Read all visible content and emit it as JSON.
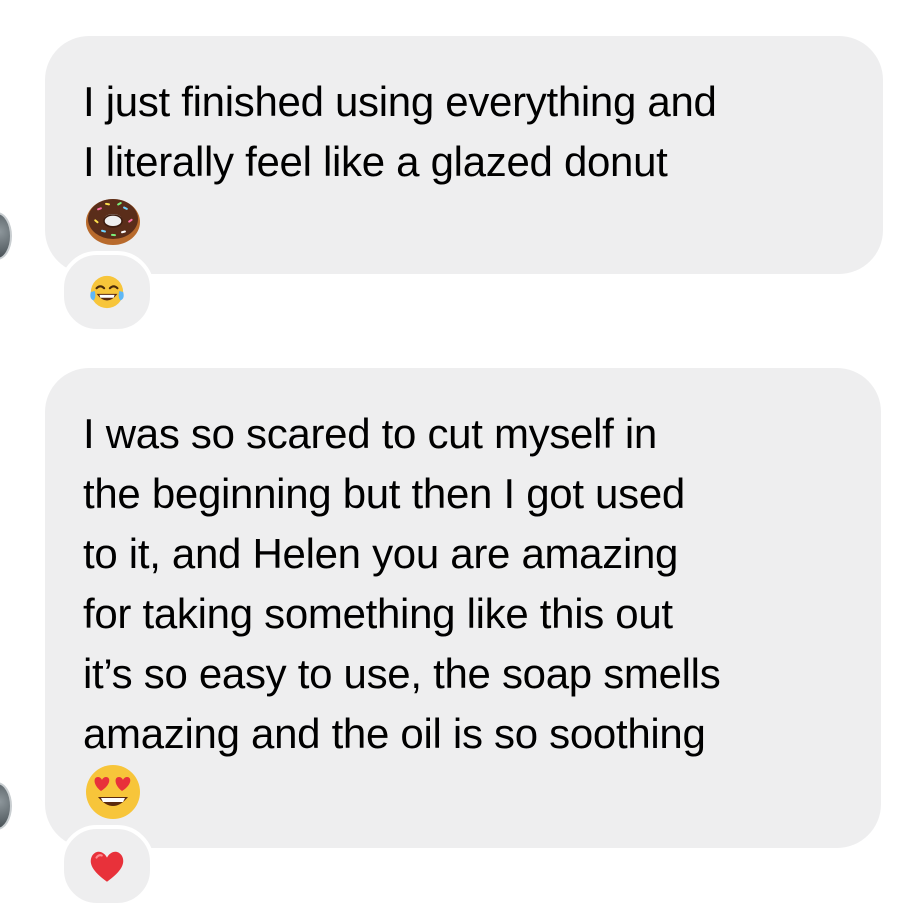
{
  "messages": [
    {
      "text": "I just finished using everything and\nI literally feel like a glazed donut",
      "emoji": "donut-emoji",
      "reaction": "tears-of-joy-emoji"
    },
    {
      "text": "I was so scared to cut myself in\nthe beginning but then I got used\nto it, and Helen you are amazing\nfor taking something like this out\nit’s so easy to use, the soap smells\namazing and the oil is so soothing",
      "emoji": "heart-eyes-emoji",
      "reaction": "red-heart-emoji"
    }
  ],
  "colors": {
    "bubble": "#eeeeef",
    "background": "#ffffff",
    "text": "#000000"
  }
}
